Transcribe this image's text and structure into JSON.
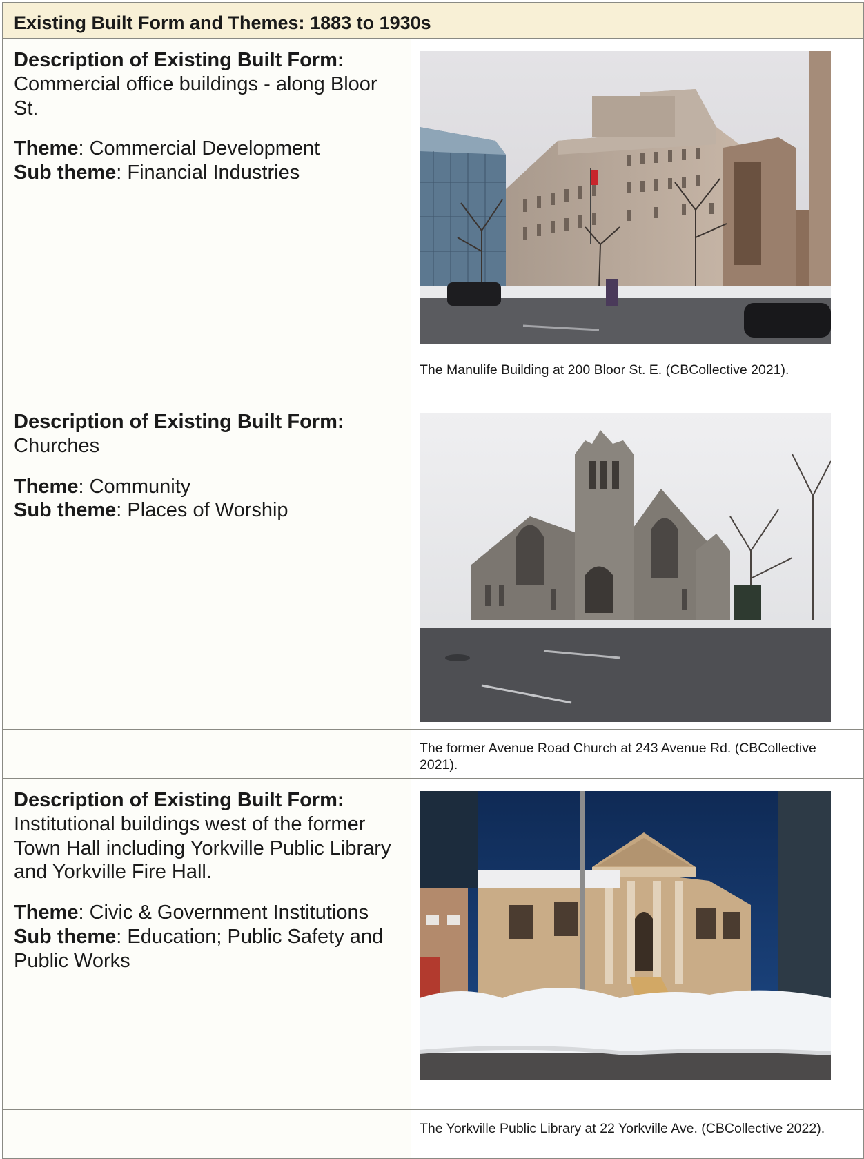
{
  "header": {
    "title": "Existing Built Form and Themes: 1883 to 1930s"
  },
  "labels": {
    "description": "Description of Existing Built Form:",
    "theme": "Theme",
    "sub_theme": "Sub theme",
    "colon": ": "
  },
  "rows": [
    {
      "description": "Commercial office buildings - along Bloor St.",
      "theme": "Commercial Development",
      "sub_theme": "Financial Industries",
      "caption": "The Manulife Building at 200 Bloor St. E. (CBCollective 2021).",
      "photo_icon": "office-building-photo"
    },
    {
      "description": "Churches",
      "theme": "Community",
      "sub_theme": "Places of Worship",
      "caption": "The former Avenue Road Church at 243 Avenue Rd. (CBCollective 2021).",
      "photo_icon": "church-photo"
    },
    {
      "description": "Institutional buildings west of the former Town Hall including Yorkville Public Library and Yorkville Fire Hall.",
      "theme": "Civic & Government Institutions",
      "sub_theme": "Education; Public Safety and Public Works",
      "caption": "The Yorkville Public Library at 22 Yorkville Ave. (CBCollective 2022).",
      "photo_icon": "library-photo"
    }
  ]
}
